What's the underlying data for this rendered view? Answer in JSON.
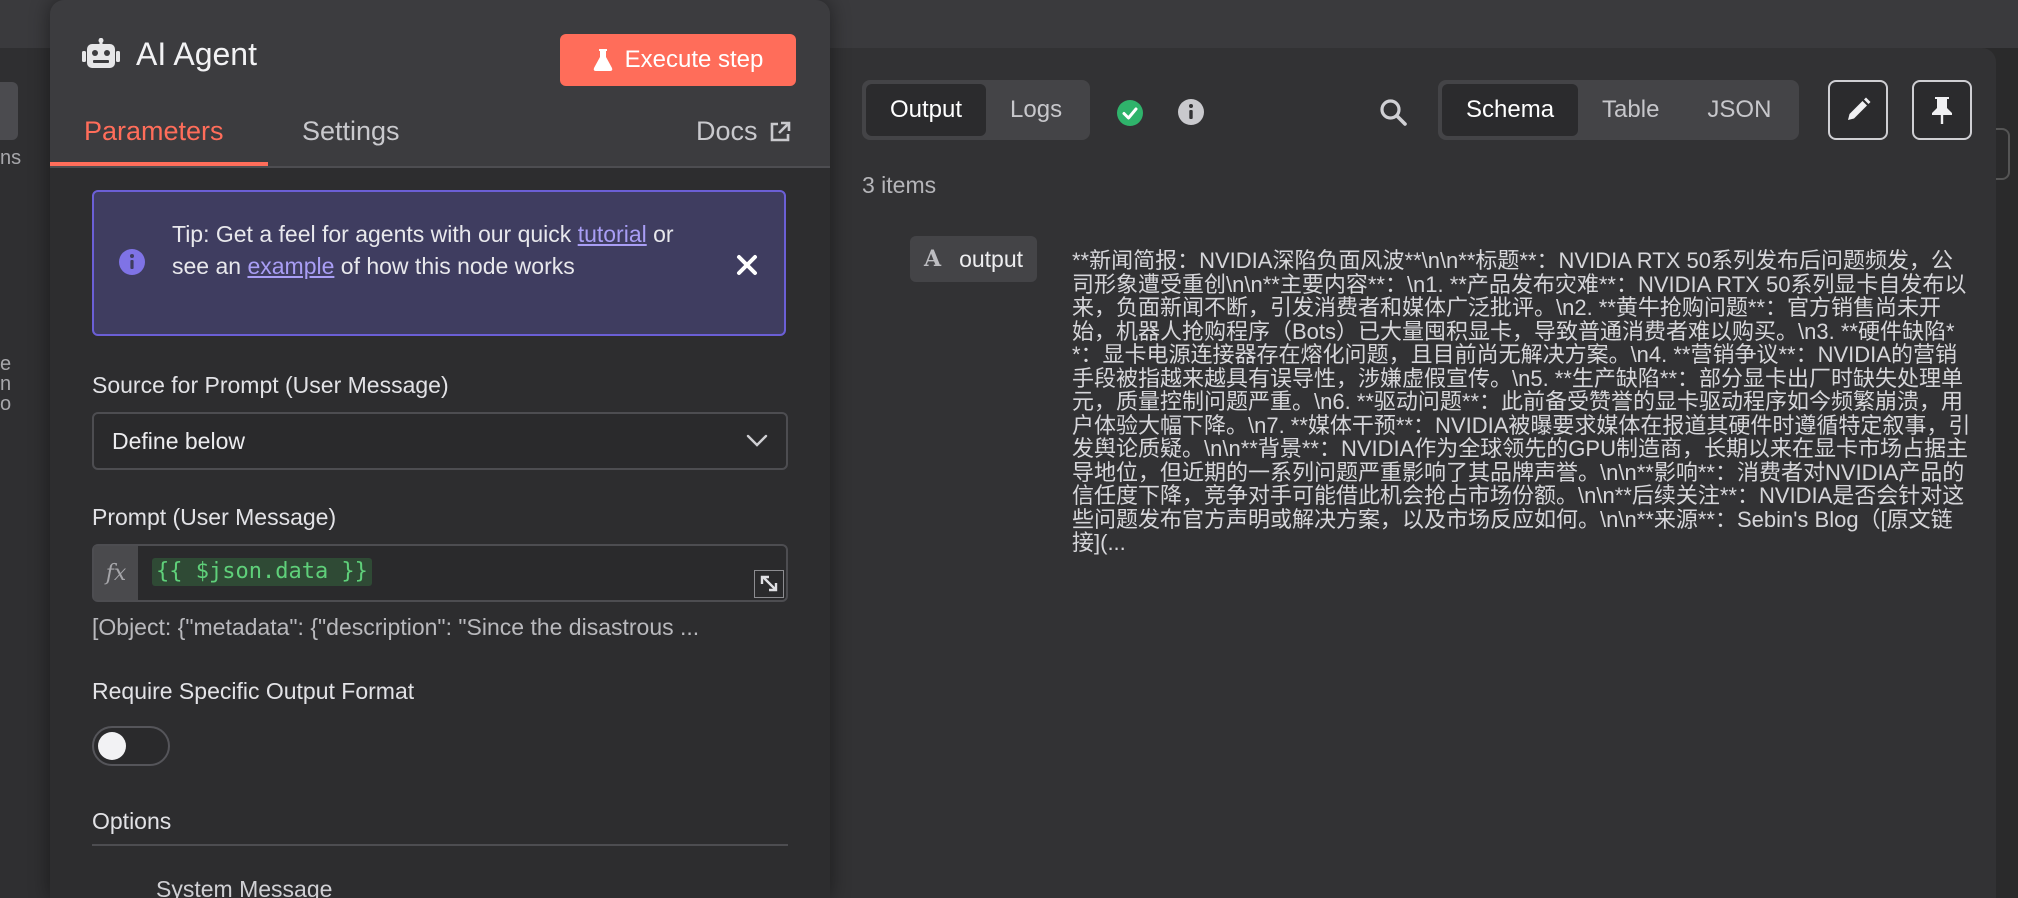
{
  "canvas": {
    "left_fragments": [
      "ns",
      "e",
      "n",
      "o"
    ]
  },
  "node_panel": {
    "icon": "robot-icon",
    "title": "AI Agent",
    "execute_label": "Execute step",
    "execute_icon": "flask-icon",
    "tabs": {
      "parameters": "Parameters",
      "settings": "Settings",
      "docs": "Docs"
    },
    "tip": {
      "part1": "Tip: Get a feel for agents with our quick ",
      "link1": "tutorial",
      "part2": " or see an ",
      "link2": "example",
      "part3": " of how this node works"
    },
    "source_label": "Source for Prompt (User Message)",
    "source_value": "Define below",
    "prompt_label": "Prompt (User Message)",
    "fx_label": "fx",
    "prompt_expression": "{{ $json.data }}",
    "prompt_preview": "[Object: {\"metadata\": {\"description\": \"Since the disastrous ...",
    "format_label": "Require Specific Output Format",
    "format_enabled": false,
    "options_label": "Options",
    "system_message_label": "System Message"
  },
  "output_panel": {
    "mode_tabs": [
      "Output",
      "Logs"
    ],
    "active_mode": "Output",
    "view_tabs": [
      "Schema",
      "Table",
      "JSON"
    ],
    "active_view": "Schema",
    "items_count": "3 items",
    "field": {
      "type_glyph": "A",
      "name": "output",
      "value": "**新闻简报：NVIDIA深陷负面风波**\\n\\n**标题**：NVIDIA RTX 50系列发布后问题频发，公司形象遭受重创\\n\\n**主要内容**：\\n1. **产品发布灾难**：NVIDIA RTX 50系列显卡自发布以来，负面新闻不断，引发消费者和媒体广泛批评。\\n2. **黄牛抢购问题**：官方销售尚未开始，机器人抢购程序（Bots）已大量囤积显卡，导致普通消费者难以购买。\\n3. **硬件缺陷**：显卡电源连接器存在熔化问题，且目前尚无解决方案。\\n4. **营销争议**：NVIDIA的营销手段被指越来越具有误导性，涉嫌虚假宣传。\\n5. **生产缺陷**：部分显卡出厂时缺失处理单元，质量控制问题严重。\\n6. **驱动问题**：此前备受赞誉的显卡驱动程序如今频繁崩溃，用户体验大幅下降。\\n7. **媒体干预**：NVIDIA被曝要求媒体在报道其硬件时遵循特定叙事，引发舆论质疑。\\n\\n**背景**：NVIDIA作为全球领先的GPU制造商，长期以来在显卡市场占据主导地位，但近期的一系列问题严重影响了其品牌声誉。\\n\\n**影响**：消费者对NVIDIA产品的信任度下降，竞争对手可能借此机会抢占市场份额。\\n\\n**后续关注**：NVIDIA是否会针对这些问题发布官方声明或解决方案，以及市场反应如何。\\n\\n**来源**：Sebin's Blog（[原文链接](..."
    },
    "colors": {
      "accent": "#ff6d5a",
      "success": "#2fb36b",
      "tip_border": "#6b5fd6",
      "expression": "#5fd07a"
    }
  }
}
